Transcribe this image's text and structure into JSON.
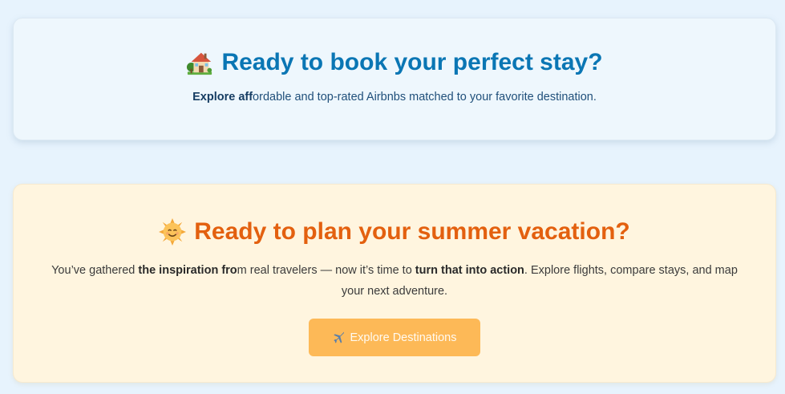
{
  "airbnb_card": {
    "icon": "house-with-garden-icon",
    "title": "Ready to book your perfect stay?",
    "subtitle_bold": "Explore aff",
    "subtitle_rest": "ordable and top-rated Airbnbs matched to your favorite destination."
  },
  "summer_card": {
    "icon": "smiling-sun-icon",
    "title": "Ready to plan your summer vacation?",
    "body_part1": "You’ve gathered ",
    "body_bold1": "the inspiration fro",
    "body_part2": "m real travelers — now it’s time to ",
    "body_bold2": "turn that into action",
    "body_part3": ". Explore flights, compare stays, and map your next adventure.",
    "button_icon": "airplane-icon",
    "button_label": "Explore Destinations"
  },
  "colors": {
    "page_bg": "#e7f3fd",
    "airbnb_title": "#0a76b4",
    "summer_title": "#e3600f",
    "button_bg": "#fdb957"
  }
}
